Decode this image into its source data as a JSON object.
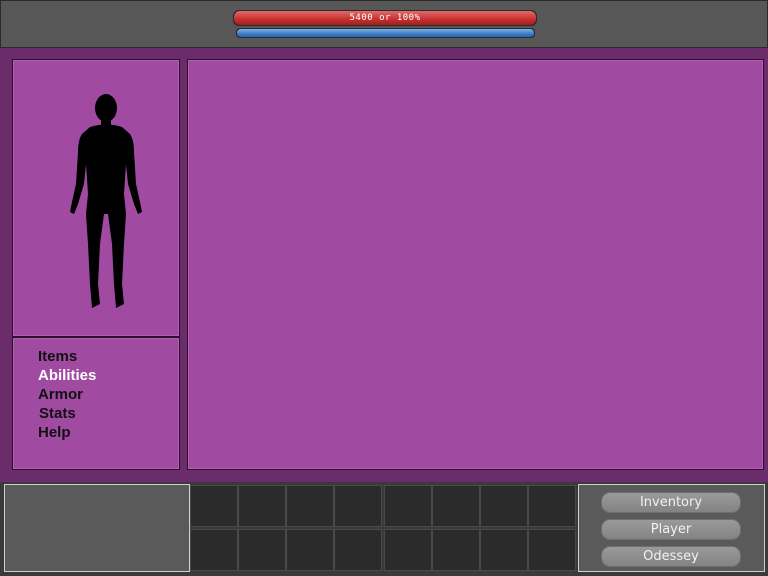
{
  "status": {
    "hp_text": "5400 or 100%",
    "hp_percent": 100,
    "mp_percent": 100,
    "hp_color": "#c62f2f",
    "mp_color": "#3a7ccc"
  },
  "character": {
    "portrait_icon": "human-silhouette-icon"
  },
  "menu": {
    "items": [
      {
        "label": "Items",
        "active": false
      },
      {
        "label": "Abilities",
        "active": true
      },
      {
        "label": "Armor",
        "active": false
      },
      {
        "label": "Stats",
        "active": false
      },
      {
        "label": "Help",
        "active": false
      }
    ]
  },
  "hotbar": {
    "slots_per_row": 8,
    "rows": 2
  },
  "buttons": {
    "inventory": "Inventory",
    "player": "Player",
    "odessey": "Odessey"
  },
  "colors": {
    "panel": "#a14aa1",
    "frame": "#6a2c6a"
  }
}
